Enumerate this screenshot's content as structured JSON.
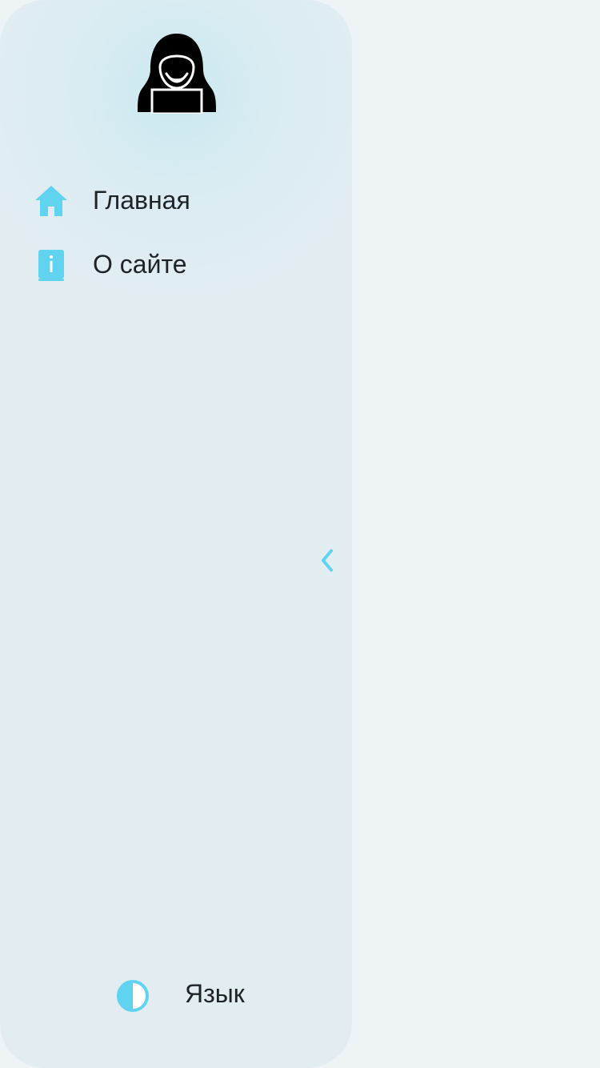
{
  "sidebar": {
    "logo_icon": "hacker-avatar-icon",
    "items": [
      {
        "label": "Главная",
        "icon": "home-icon"
      },
      {
        "label": "О сайте",
        "icon": "info-book-icon"
      }
    ],
    "collapse_icon": "chevron-left-icon",
    "footer": {
      "theme_icon": "contrast-icon",
      "language_label": "Язык"
    }
  },
  "colors": {
    "accent": "#5fd3f0",
    "sidebar_bg": "#e2edf2",
    "page_bg": "#eef3f6",
    "text": "#1e2326"
  }
}
